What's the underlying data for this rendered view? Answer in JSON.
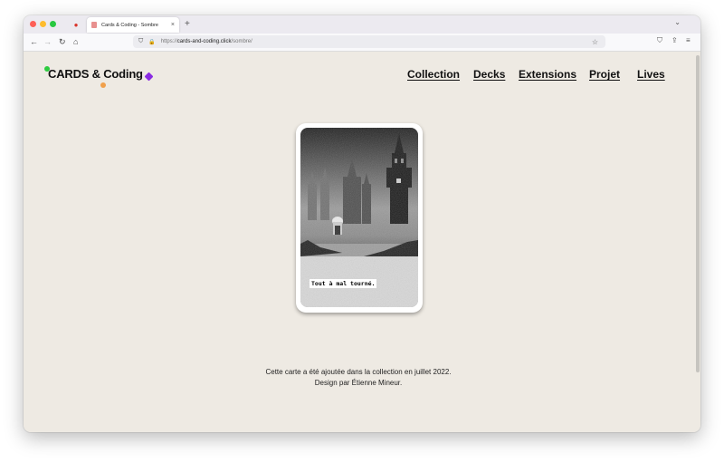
{
  "browser": {
    "tab_title": "Cards & Coding - Sombre",
    "tab_close": "×",
    "new_tab": "+",
    "tab_list": "⌄",
    "pinned_tab_icon": "●",
    "nav": {
      "back": "←",
      "forward": "→",
      "reload": "↻",
      "home": "⌂"
    },
    "url_scheme": "https://",
    "url_host": "cards-and-coding.click",
    "url_path": "/sombre/",
    "url_shield": "⛉",
    "url_lock": "🔒",
    "bookmark_star": "☆",
    "toolbar": {
      "pocket": "⛉",
      "extensions": "⇪",
      "menu": "≡"
    }
  },
  "site": {
    "logo_text": "CARDS & Coding",
    "logo_colors": {
      "green": "#2ecc40",
      "orange": "#f0a04b",
      "purple": "#8a2be2"
    },
    "nav": [
      "Collection",
      "Decks",
      "Extensions",
      "Projet",
      "Lives"
    ]
  },
  "card": {
    "caption": "Tout à mal tourné."
  },
  "info": {
    "line1": "Cette carte a été ajoutée dans la collection en juillet 2022.",
    "line2": "Design par Étienne Mineur."
  }
}
